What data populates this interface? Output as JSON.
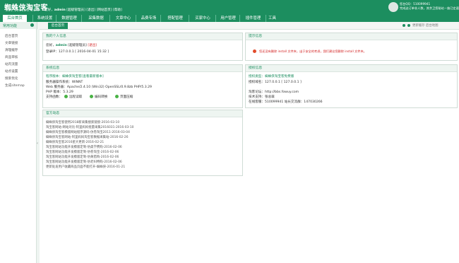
{
  "header": {
    "title": "蜘蛛侠淘宝客",
    "subtitle": "885.1008BG.COM",
    "welcome_prefix": "您好，",
    "username": "admin",
    "welcome_role": "[超级管理员]",
    "logout": "[退出]",
    "site_home": "[网站首页]",
    "help": "[帮助]",
    "user_line1": "您台QQ：510099941",
    "user_line2": "完成这订单非人数，其余卫您秘站－施已定速"
  },
  "nav": {
    "items": [
      "后台首页",
      "系统设置",
      "数据管理",
      "采集数据",
      "文章中心",
      "品费专场",
      "搭配管理",
      "买家中心",
      "用户管理",
      "插件管理",
      "工具"
    ],
    "active_index": 0
  },
  "sidebar": {
    "title": "常用功能",
    "items": [
      "后台首页",
      "文章链接",
      "清理缓存",
      "商品审核",
      "站内流量",
      "站点设置",
      "搜索优化",
      "生成sitemap"
    ]
  },
  "tabbar": {
    "home_tab": "后台首页",
    "tools_text": "更新缓存    后台地图"
  },
  "panels": {
    "info": {
      "title": "我的个人信息",
      "line1_label": "您好，",
      "line1_user": "admin",
      "line1_role": "[超级管理员]",
      "line1_logout": "[退出]",
      "line2": "登录IP：127.0.0.1 [ 2016-04-01 15:32 ]"
    },
    "tips": {
      "title": "提示信息",
      "warning": "您还没有删除 install 文件夹，出于安全的考虑，我们建议您删除 install 文件夹。"
    },
    "system": {
      "title": "系统信息",
      "program": "程序版本：蜘蛛侠淘宝客[查看最新版本]",
      "os": "服务器操作系统：WINNT",
      "web": "Web 服务器：Apache/2.4.10 (Win32) OpenSSL/0.9.8zb PHP/5.3.29",
      "php": "PHP 版本：5.3.29",
      "support": "支持函数：",
      "checks": [
        "远程读取",
        "编码转换",
        "页面压缩"
      ]
    },
    "license": {
      "title": "授权信息",
      "type": "授权类型：蜘蛛侠淘宝客免费版",
      "domain": "授权域名：127.0.0.1 [ 127.0.0.1 ]",
      "official": "淘客论坛：http://bbs.fowuy.com",
      "tech": "技术支持：张总裁",
      "contact": "在线客服：510099941    站长交流群：147030266"
    },
    "news": {
      "title": "官方动态",
      "items": [
        "蜘蛛侠淘宝客使用2018新采集搜索链接-2016-03-10",
        "淘宝客网站-网站对比-阿里妈妈批量采集2016031-2016-03-10",
        "蜘蛛侠淘宝客模版网站程序源码-仿卷淘宝2011-2016-03-04",
        "蜘蛛侠淘宝客网站-阿里妈妈淘宝客数据采集站-2016-02-26",
        "蜘蛛侠淘宝客2016星大更新-2016-02-21",
        "淘宝客网站功能开发模版定制-仿类学费购-2016-02-06",
        "淘宝客网站功能开发模版定制-仿卷淘宝-2016-02-06",
        "淘宝客网站功能开发模版定制-仿黄猎购-2016-02-06",
        "淘宝客网站功能开发模版定制-仿老妇特购-2016-02-06",
        "更新处发用户收藏商品页面不能打开-蜘蛛侠-2016-01-21"
      ]
    }
  },
  "colors": {
    "brand": "#1c8e5f",
    "warning": "#d21f1f",
    "ok": "#49b245"
  }
}
